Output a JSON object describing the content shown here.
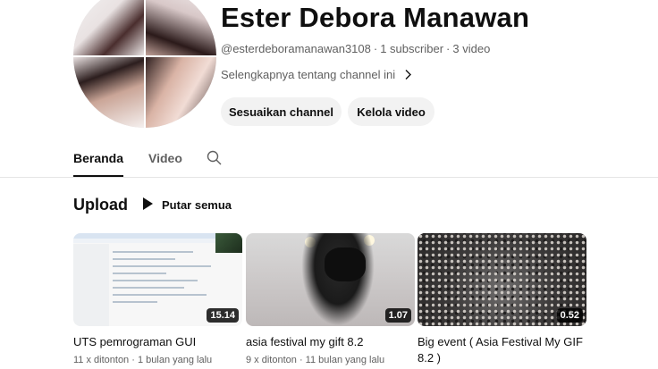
{
  "channel": {
    "name": "Ester Debora Manawan",
    "handle": "@esterdeboramanawan3108",
    "subscribers": "1 subscriber",
    "video_count": "3 video",
    "separator": "·",
    "about_label": "Selengkapnya tentang channel ini",
    "customize_label": "Sesuaikan channel",
    "manage_label": "Kelola video"
  },
  "tabs": [
    {
      "label": "Beranda",
      "active": true
    },
    {
      "label": "Video",
      "active": false
    }
  ],
  "section": {
    "title": "Upload",
    "play_all_label": "Putar semua"
  },
  "videos": [
    {
      "title": "UTS pemrograman GUI",
      "duration": "15.14",
      "views": "11 x ditonton",
      "age": "1 bulan yang lalu"
    },
    {
      "title": "asia festival my gift 8.2",
      "duration": "1.07",
      "views": "9 x ditonton",
      "age": "11 bulan yang lalu"
    },
    {
      "title": "Big event ( Asia Festival My GIF 8.2 )",
      "duration": "0.52",
      "views": "",
      "age": ""
    }
  ],
  "icons": {
    "search": "search-icon",
    "chevron": "chevron-right-icon",
    "play": "play-icon"
  },
  "colors": {
    "text_primary": "#0f0f0f",
    "text_secondary": "#606060",
    "pill_bg": "#f2f2f2"
  }
}
